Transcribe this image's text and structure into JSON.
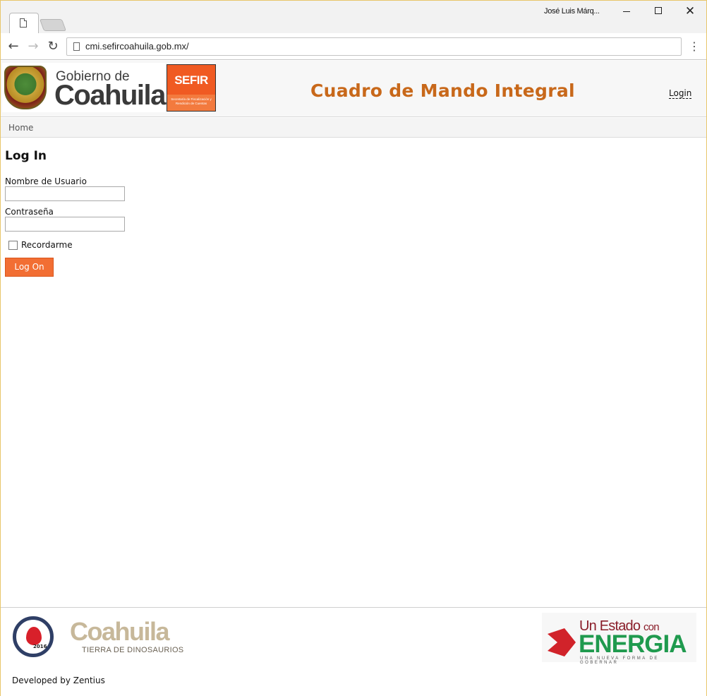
{
  "browser": {
    "profile_name": "José Luis Márq...",
    "window_close_glyph": "✕",
    "back_glyph": "←",
    "forward_glyph": "→",
    "reload_glyph": "↻",
    "menu_glyph": "⋮",
    "url": "cmi.sefircoahuila.gob.mx/"
  },
  "header": {
    "gov_logo_line1": "Gobierno de",
    "gov_logo_line2": "Coahuila",
    "sefir_logo_title": "SEFIR",
    "sefir_logo_subtitle": "Secretaría de Fiscalización y Rendición de Cuentas",
    "title": "Cuadro de Mando Integral",
    "login_link": "Login",
    "title_color": "#c8681a"
  },
  "breadcrumb": {
    "home": "Home"
  },
  "login_form": {
    "title": "Log In",
    "username_label": "Nombre de Usuario",
    "username_value": "",
    "password_label": "Contraseña",
    "password_value": "",
    "remember_label": "Recordarme",
    "remember_checked": false,
    "submit_label": "Log On",
    "submit_color": "#f26e33"
  },
  "footer": {
    "badge_year": "2016",
    "coahuila_word": "Coahuila",
    "coahuila_tagline": "TIERRA DE DINOSAURIOS",
    "energia_top_a": "Un Estado",
    "energia_top_b": "con",
    "energia_main": "ENERGIA",
    "energia_tagline": "UNA NUEVA FORMA DE GOBERNAR",
    "developed_by": "Developed by Zentius"
  }
}
